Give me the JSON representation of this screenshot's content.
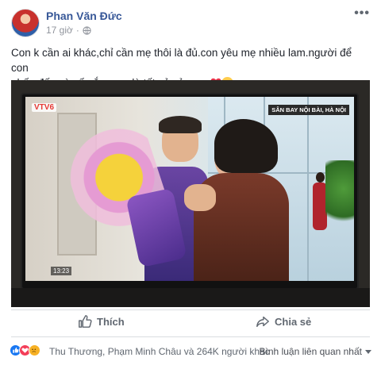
{
  "post": {
    "author": "Phan Văn Đức",
    "time": "17 giờ",
    "more_glyph": "•••",
    "text_line1": "Con k cần ai khác,chỉ cần mẹ thôi là đủ.con yêu mẹ nhiều lam.người để con",
    "text_line2": "phấn đấu và cố gắng.mẹ là tất cả của con"
  },
  "photo": {
    "channel_logo": "VTV6",
    "location_caption": "SÂN BAY NỘI BÀI, HÀ NỘI",
    "clock": "13:23"
  },
  "actions": {
    "like_label": "Thích",
    "share_label": "Chia sẻ"
  },
  "footer": {
    "reaction_icons": [
      "like-icon",
      "love-icon",
      "sad-icon"
    ],
    "reaction_summary": "Thu Thương, Phạm Minh Châu và 264K người khác",
    "comment_filter": "Bình luận liên quan nhất"
  },
  "colors": {
    "author_link": "#385898",
    "like_blue": "#1877f2",
    "love_red": "#f33e58",
    "sad_yellow": "#f7b125"
  }
}
